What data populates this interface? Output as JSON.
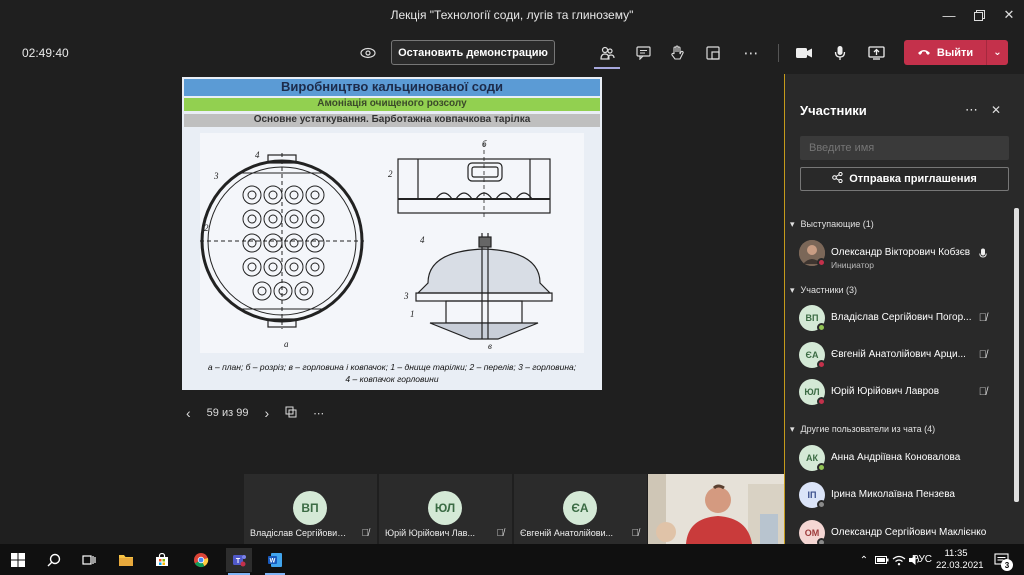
{
  "window": {
    "title": "Лекція \"Технології соди, лугів та глинозему\"",
    "minimize_icon": "minimize-icon",
    "maximize_icon": "restore-icon",
    "close_icon": "close-icon"
  },
  "toolbar": {
    "timer": "02:49:40",
    "stop_share_label": "Остановить демонстрацию",
    "leave_label": "Выйти",
    "leave_color": "#c4314b"
  },
  "slide": {
    "title": "Виробництво кальцинованої соди",
    "subtitle": "Амоніація очищеного розсолу",
    "section": "Основне устаткування. Барботажна ковпачкова тарілка",
    "caption_line1": "а – план; б – розріз; в – горловина і ковпачок; 1 – днище тарілки; 2 – перелів; 3 – горловина;",
    "caption_line2": "4 – ковпачок горловини",
    "labels": {
      "a": "а",
      "b": "б",
      "v": "в",
      "n1": "1",
      "n2": "2",
      "n3": "3",
      "n4": "4"
    },
    "title_band_color": "#5b9bd5",
    "subtitle_band_color": "#92d050"
  },
  "slide_nav": {
    "counter": "59 из 99"
  },
  "panel": {
    "title": "Участники",
    "search_placeholder": "Введите имя",
    "invite_label": "Отправка приглашения",
    "presenters_header": "Выступающие (1)",
    "participants_header": "Участники (3)",
    "others_header": "Другие пользователи из чата (4)",
    "presenter": {
      "name": "Олександр Вікторович Кобзєв",
      "role": "Инициатор"
    },
    "participants": [
      {
        "initials": "ВП",
        "name": "Владіслав Сергійович Погор..."
      },
      {
        "initials": "ЄА",
        "name": "Євгеній Анатолійович Арци..."
      },
      {
        "initials": "ЮЛ",
        "name": "Юрій Юрійович Лавров"
      }
    ],
    "others": [
      {
        "initials": "АК",
        "name": "Анна Андріївна Коновалова"
      },
      {
        "initials": "ІП",
        "name": "Ірина Миколаївна Пензева"
      },
      {
        "initials": "ОМ",
        "name": "Олександр Сергійович Маклієнко"
      }
    ]
  },
  "strip": {
    "tiles": [
      {
        "initials": "ВП",
        "label": "Владіслав Сергійович..."
      },
      {
        "initials": "ЮЛ",
        "label": "Юрій Юрійович Лав..."
      },
      {
        "initials": "ЄА",
        "label": "Євгеній Анатолійови..."
      }
    ]
  },
  "taskbar": {
    "lang": "РУС",
    "time": "11:35",
    "date": "22.03.2021",
    "notifications": "3"
  }
}
